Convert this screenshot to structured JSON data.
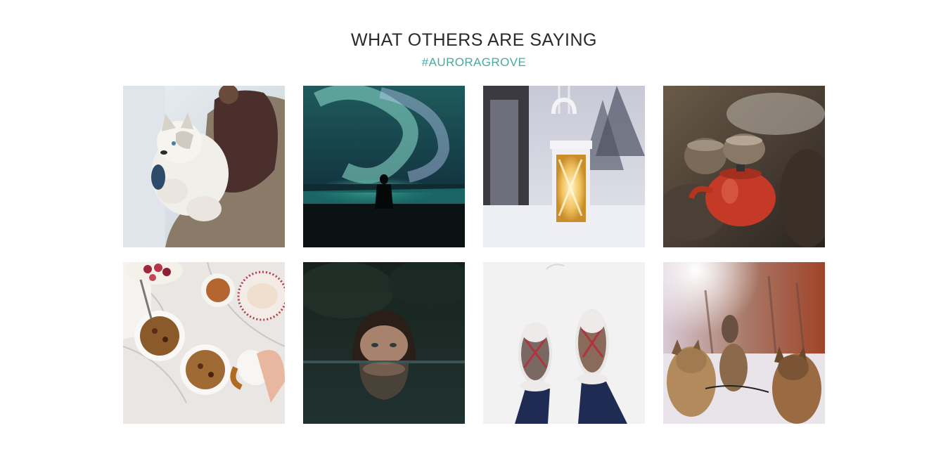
{
  "section": {
    "title": "WHAT OTHERS ARE SAYING",
    "hashtag": "#AURORAGROVE"
  },
  "gallery": {
    "items": [
      {
        "subject": "husky-puppy-held-in-arms",
        "icon": "photo-icon"
      },
      {
        "subject": "northern-lights-silhouette",
        "icon": "photo-icon"
      },
      {
        "subject": "frosted-lantern-in-snow",
        "icon": "photo-icon"
      },
      {
        "subject": "kettles-on-campfire",
        "icon": "photo-icon"
      },
      {
        "subject": "oatmeal-bowls-and-fruit",
        "icon": "photo-icon"
      },
      {
        "subject": "woman-in-dark-water",
        "icon": "photo-icon"
      },
      {
        "subject": "snowy-boots-from-above",
        "icon": "photo-icon"
      },
      {
        "subject": "sled-dogs-in-snow",
        "icon": "photo-icon"
      }
    ]
  },
  "colors": {
    "accent": "#4da89f",
    "title": "#2a2a2a",
    "background": "#ffffff"
  }
}
